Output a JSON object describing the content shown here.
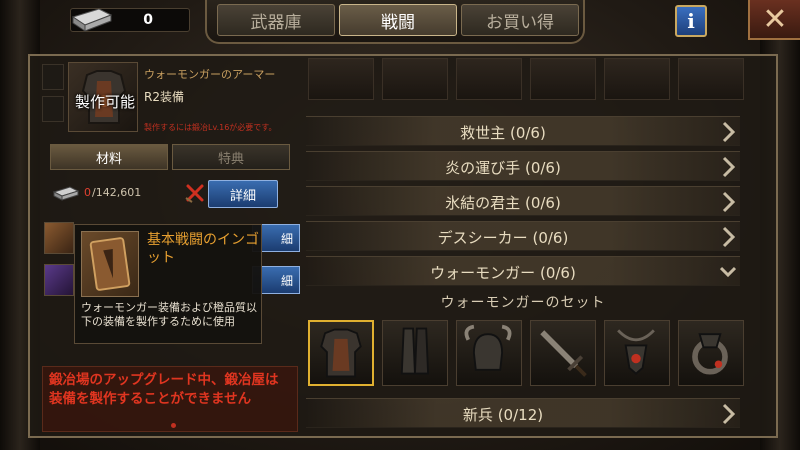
{
  "currency": {
    "icon": "ingot-icon",
    "value": "0"
  },
  "tabs": [
    {
      "label": "武器庫",
      "active": false
    },
    {
      "label": "戦闘",
      "active": true
    },
    {
      "label": "お買い得",
      "active": false
    }
  ],
  "info_button": "i",
  "close_button": "✕",
  "item": {
    "badge": "製作可能",
    "name": "ウォーモンガーのアーマー",
    "grade": "R2装備",
    "requirement": "製作するには鍛冶Lv.16が必要です。"
  },
  "subtabs": {
    "materials": "材料",
    "perks": "特典"
  },
  "material": {
    "have": "0",
    "need": "/142,601",
    "detail_label": "詳細"
  },
  "bonus_buttons": [
    "細",
    "細"
  ],
  "warning": "鍛冶場のアップグレード中、鍛冶屋は装備を製作することができません",
  "tooltip": {
    "title": "基本戦闘のインゴット",
    "description": "ウォーモンガー装備および橙品質以下の装備を製作するために使用"
  },
  "categories": [
    {
      "label": "救世主",
      "count": "(0/6)",
      "expanded": false
    },
    {
      "label": "炎の運び手",
      "count": "(0/6)",
      "expanded": false
    },
    {
      "label": "氷結の君主",
      "count": "(0/6)",
      "expanded": false
    },
    {
      "label": "デスシーカー",
      "count": "(0/6)",
      "expanded": false
    },
    {
      "label": "ウォーモンガー",
      "count": "(0/6)",
      "expanded": true
    }
  ],
  "set_title": "ウォーモンガーのセット",
  "set_items": [
    "armor-icon",
    "greaves-icon",
    "helmet-icon",
    "sword-icon",
    "amulet-icon",
    "ring-icon"
  ],
  "bottom_category": {
    "label": "新兵",
    "count": "(0/12)"
  }
}
